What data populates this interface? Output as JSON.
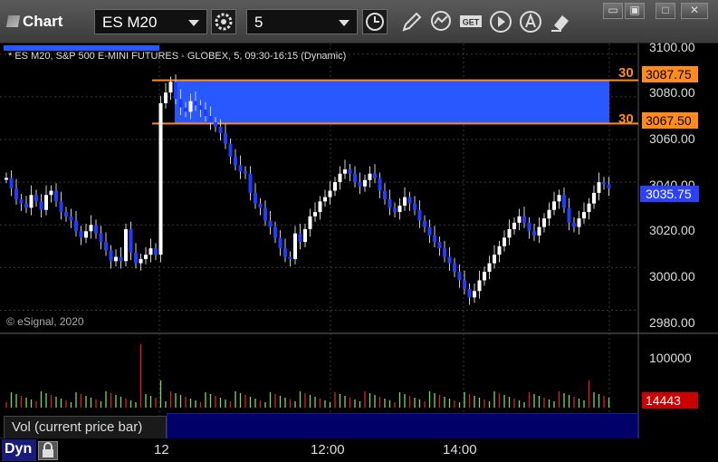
{
  "window": {
    "title": "Chart",
    "symbol": "ES M20",
    "interval": "5",
    "controls": [
      "restore",
      "maximize",
      "close"
    ]
  },
  "toolbar": {
    "icons": [
      "settings-gear-icon",
      "clock-icon",
      "pencil-icon",
      "study-icon",
      "get-icon",
      "play-icon",
      "alert-icon",
      "eraser-icon"
    ]
  },
  "chart": {
    "header": "* ES M20, S&P 500 E-MINI FUTURES - GLOBEX, 5, 09:30-16:15 (Dynamic)",
    "copyright": "© eSignal, 2020",
    "price_axis": [
      "3100.00",
      "3080.00",
      "3060.00",
      "3040.00",
      "3020.00",
      "3000.00",
      "2980.00"
    ],
    "zone_high": "3087.75",
    "zone_low": "3067.50",
    "zone_flag_high": "30",
    "zone_flag_low": "30",
    "last_price": "3035.75",
    "time_axis": [
      "12",
      "12:00",
      "14:00"
    ]
  },
  "volume": {
    "legend": "Vol (current price bar)",
    "close_glyph": "×",
    "axis_label": "100000",
    "last_volume": "14443",
    "mode": "Dyn"
  },
  "colors": {
    "up": "#ffffff",
    "down": "#1f3dff",
    "zone": "#2a58ff",
    "zone_line": "#ff8c1a",
    "vol_up": "#7ed957",
    "vol_down": "#e02020"
  },
  "chart_data": {
    "type": "candlestick",
    "symbol": "ES M20",
    "y_range": [
      2970,
      3105
    ],
    "zone": [
      3067.5,
      3087.75
    ],
    "closes": [
      3042,
      3037,
      3032,
      3030,
      3028,
      3034,
      3031,
      3027,
      3034,
      3036,
      3031,
      3026,
      3024,
      3022,
      3017,
      3014,
      3017,
      3020,
      3016,
      3012,
      3008,
      3003,
      3005,
      3003,
      3018,
      3007,
      3002,
      3004,
      3006,
      3009,
      3006,
      3077,
      3082,
      3087,
      3079,
      3075,
      3073,
      3078,
      3076,
      3074,
      3071,
      3068,
      3066,
      3063,
      3058,
      3052,
      3048,
      3045,
      3044,
      3035,
      3030,
      3028,
      3022,
      3019,
      3014,
      3009,
      3005,
      3004,
      3016,
      3012,
      3018,
      3024,
      3026,
      3031,
      3033,
      3036,
      3040,
      3044,
      3046,
      3044,
      3040,
      3038,
      3041,
      3044,
      3042,
      3036,
      3032,
      3028,
      3026,
      3029,
      3033,
      3030,
      3027,
      3022,
      3019,
      3015,
      3012,
      3009,
      3005,
      3002,
      2998,
      2994,
      2990,
      2986,
      2989,
      2994,
      2998,
      3002,
      3006,
      3010,
      3014,
      3018,
      3021,
      3024,
      3021,
      3017,
      3015,
      3019,
      3023,
      3027,
      3031,
      3034,
      3028,
      3021,
      3019,
      3023,
      3026,
      3030,
      3035,
      3040,
      3039,
      3037
    ],
    "volume_max_label": 100000,
    "last_volume": 14443
  }
}
